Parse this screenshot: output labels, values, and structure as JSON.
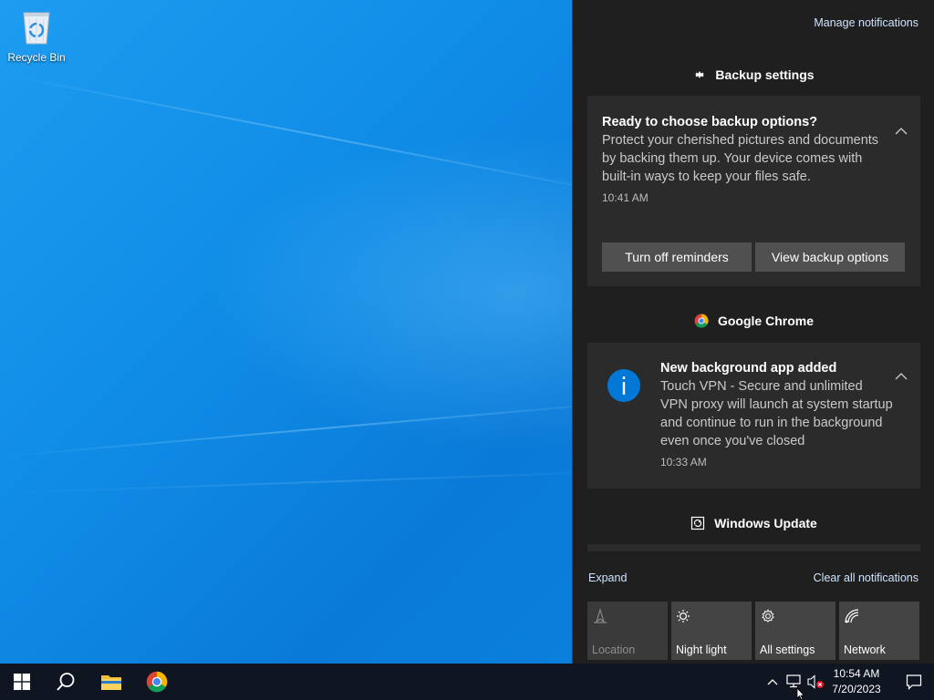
{
  "desktop": {
    "recycle_bin_label": "Recycle Bin"
  },
  "action_center": {
    "manage_link": "Manage notifications",
    "groups": [
      {
        "app": "Backup settings",
        "icon": "gear-icon",
        "notification": {
          "title": "Ready to choose backup options?",
          "body": "Protect your cherished pictures and documents by backing them up. Your device comes with built-in ways to keep your files safe.",
          "time": "10:41 AM",
          "buttons": [
            "Turn off reminders",
            "View backup options"
          ]
        }
      },
      {
        "app": "Google Chrome",
        "icon": "chrome-icon",
        "notification": {
          "title": "New background app added",
          "body": "Touch VPN - Secure and unlimited VPN proxy will launch at system startup and continue to run in the background even once you've closed",
          "time": "10:33 AM",
          "icon": "info-icon"
        }
      },
      {
        "app": "Windows Update",
        "icon": "windows-update-icon"
      }
    ],
    "expand_label": "Expand",
    "clear_all_label": "Clear all notifications",
    "quick_actions": [
      {
        "label": "Location",
        "icon": "location-icon",
        "enabled": false
      },
      {
        "label": "Night light",
        "icon": "night-light-icon",
        "enabled": true
      },
      {
        "label": "All settings",
        "icon": "gear-icon",
        "enabled": true
      },
      {
        "label": "Network",
        "icon": "network-icon",
        "enabled": true
      }
    ]
  },
  "taskbar": {
    "start_icon": "windows-logo-icon",
    "search_icon": "search-icon",
    "pinned": [
      "file-explorer-icon",
      "chrome-icon"
    ],
    "tray": {
      "time": "10:54 AM",
      "date": "7/20/2023",
      "icons": [
        "chevron-up-icon",
        "network-icon",
        "volume-muted-icon"
      ]
    }
  },
  "colors": {
    "panel_bg": "#1f1f1f",
    "card_bg": "#2b2b2b",
    "button_bg": "#505050",
    "link": "#cfe4ff",
    "info_blue": "#0078d7",
    "taskbar_bg": "#0f1521"
  }
}
